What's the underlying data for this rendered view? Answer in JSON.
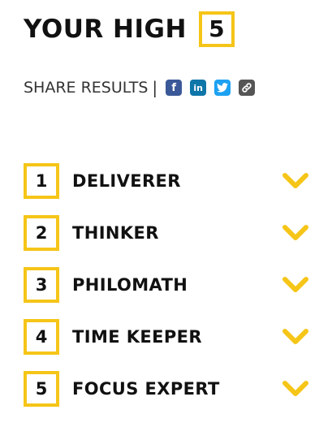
{
  "header": {
    "title": "YOUR HIGH",
    "count": "5"
  },
  "share": {
    "label": "SHARE RESULTS",
    "separator": "|",
    "icons": [
      {
        "name": "facebook-icon",
        "glyph": "f"
      },
      {
        "name": "linkedin-icon",
        "glyph": "in"
      },
      {
        "name": "twitter-icon",
        "glyph": ""
      },
      {
        "name": "link-icon",
        "glyph": ""
      }
    ]
  },
  "results": [
    {
      "rank": "1",
      "label": "DELIVERER"
    },
    {
      "rank": "2",
      "label": "THINKER"
    },
    {
      "rank": "3",
      "label": "PHILOMATH"
    },
    {
      "rank": "4",
      "label": "TIME KEEPER"
    },
    {
      "rank": "5",
      "label": "FOCUS EXPERT"
    }
  ],
  "colors": {
    "accent": "#f5c518",
    "text": "#111111",
    "facebook": "#3b5998",
    "linkedin": "#0e76a8",
    "twitter": "#1da1f2",
    "link": "#555555"
  }
}
